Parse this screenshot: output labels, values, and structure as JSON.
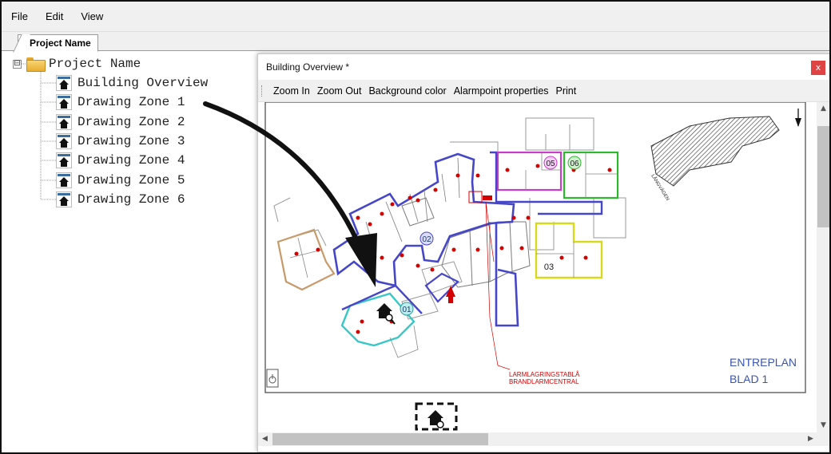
{
  "menu": {
    "file": "File",
    "edit": "Edit",
    "view": "View"
  },
  "tabs": [
    {
      "label": "Project Name"
    }
  ],
  "tree": {
    "root": {
      "label": "Project Name",
      "expander": "⊟"
    },
    "items": [
      {
        "label": "Building Overview"
      },
      {
        "label": "Drawing Zone 1"
      },
      {
        "label": "Drawing Zone 2"
      },
      {
        "label": "Drawing Zone 3"
      },
      {
        "label": "Drawing Zone 4"
      },
      {
        "label": "Drawing Zone 5"
      },
      {
        "label": "Drawing Zone 6"
      }
    ]
  },
  "window": {
    "title": "Building Overview *",
    "close_glyph": "x",
    "toolbar": {
      "zoom_in": "Zoom In",
      "zoom_out": "Zoom Out",
      "background_color": "Background color",
      "alarmpoint_properties": "Alarmpoint properties",
      "print": "Print"
    }
  },
  "floorplan": {
    "zones": [
      "01",
      "02",
      "03",
      "05",
      "06"
    ],
    "central_label_1": "LARMLAGRINGSTABLÅ",
    "central_label_2": "BRANDLARMCENTRAL",
    "sheet_label_1": "ENTREPLAN",
    "sheet_label_2": "BLAD 1",
    "street_label": "LÅNGVÄGEN"
  },
  "colors": {
    "zone_blue": "#4646c8",
    "zone_cyan": "#36c8c8",
    "zone_magenta": "#c83cc8",
    "zone_green": "#2eb82e",
    "zone_yellow": "#d8d81e",
    "zone_tan": "#c89a6a",
    "alarm_red": "#d40000",
    "close_red": "#e04343",
    "plan_label": "#3a55b0"
  }
}
